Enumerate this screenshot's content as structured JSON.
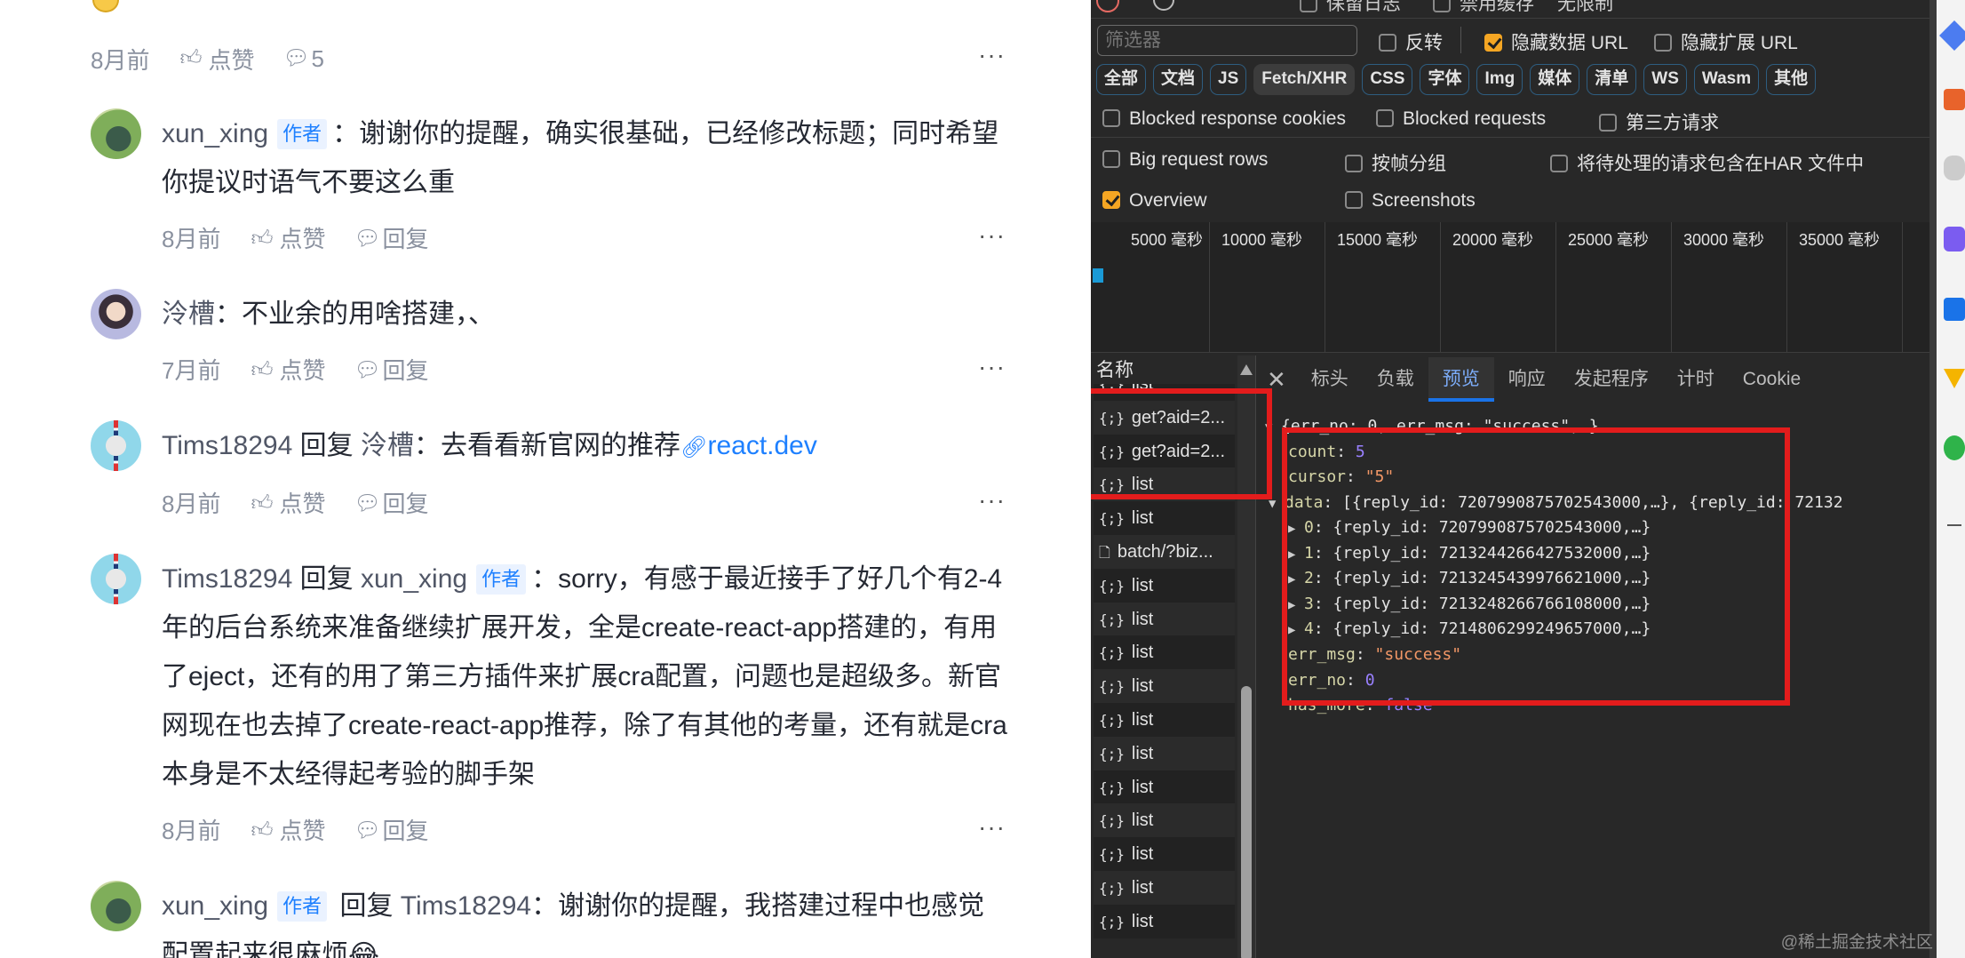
{
  "comments_panel": {
    "top_meta": {
      "time": "8月前",
      "like": "点赞",
      "reply_count": "5",
      "more": "···"
    },
    "author_badge": "作者",
    "reply_word": "回复",
    "comments": [
      {
        "name": "xun_xing",
        "is_author": true,
        "reply_to": null,
        "reply_to_author": false,
        "text": "：谢谢你的提醒，确实很基础，已经修改标题；同时希望你提议时语气不要这么重",
        "link": null,
        "time": "8月前",
        "like": "点赞",
        "reply": "回复",
        "avatar": "green"
      },
      {
        "name": "泠槽",
        "is_author": false,
        "reply_to": null,
        "reply_to_author": false,
        "text": "：不业余的用啥搭建，、",
        "link": null,
        "time": "7月前",
        "like": "点赞",
        "reply": "回复",
        "avatar": "girl"
      },
      {
        "name": "Tims18294",
        "is_author": false,
        "reply_to": "泠槽",
        "reply_to_author": false,
        "text": "：去看看新官网的推荐",
        "link": "react.dev",
        "time": "8月前",
        "like": "点赞",
        "reply": "回复",
        "avatar": "watch"
      },
      {
        "name": "Tims18294",
        "is_author": false,
        "reply_to": "xun_xing",
        "reply_to_author": true,
        "text": "：sorry，有感于最近接手了好几个有2-4年的后台系统来准备继续扩展开发，全是create-react-app搭建的，有用了eject，还有的用了第三方插件来扩展cra配置，问题也是超级多。新官网现在也去掉了create-react-app推荐，除了有其他的考量，还有就是cra本身是不太经得起考验的脚手架",
        "link": null,
        "time": "8月前",
        "like": "点赞",
        "reply": "回复",
        "avatar": "watch"
      },
      {
        "name": "xun_xing",
        "is_author": true,
        "reply_to": "Tims18294",
        "reply_to_author": false,
        "text": "：谢谢你的提醒，我搭建过程中也感觉配置起来很麻烦😂",
        "link": null,
        "time": null,
        "like": null,
        "reply": null,
        "avatar": "green"
      }
    ]
  },
  "devtools": {
    "toolbar": {
      "preserve_log": "保留日志",
      "disable_cache": "禁用缓存",
      "throttle": "无限制"
    },
    "filter": {
      "placeholder": "筛选器",
      "invert": "反转",
      "hide_data_url": "隐藏数据 URL",
      "hide_ext_url": "隐藏扩展 URL",
      "hide_data_url_checked": true
    },
    "types": [
      {
        "label": "全部",
        "active": false
      },
      {
        "label": "文档",
        "active": false
      },
      {
        "label": "JS",
        "active": false
      },
      {
        "label": "Fetch/XHR",
        "active": true
      },
      {
        "label": "CSS",
        "active": false
      },
      {
        "label": "字体",
        "active": false
      },
      {
        "label": "Img",
        "active": false
      },
      {
        "label": "媒体",
        "active": false
      },
      {
        "label": "清单",
        "active": false
      },
      {
        "label": "WS",
        "active": false
      },
      {
        "label": "Wasm",
        "active": false
      },
      {
        "label": "其他",
        "active": false
      }
    ],
    "options": {
      "blocked_cookies": "Blocked response cookies",
      "blocked_requests": "Blocked requests",
      "third_party": "第三方请求",
      "big_rows": "Big request rows",
      "group_by_frame": "按帧分组",
      "har_pending": "将待处理的请求包含在HAR 文件中",
      "overview": "Overview",
      "overview_checked": true,
      "screenshots": "Screenshots"
    },
    "timeline_ticks": [
      "5000 毫秒",
      "10000 毫秒",
      "15000 毫秒",
      "20000 毫秒",
      "25000 毫秒",
      "30000 毫秒",
      "35000 毫秒"
    ],
    "name_header": "名称",
    "requests": [
      {
        "name": "list",
        "icon": "{;}"
      },
      {
        "name": "get?aid=2...",
        "icon": "{;}"
      },
      {
        "name": "get?aid=2...",
        "icon": "{;}"
      },
      {
        "name": "list",
        "icon": "{;}"
      },
      {
        "name": "list",
        "icon": "{;}"
      },
      {
        "name": "batch/?biz...",
        "icon": "doc"
      },
      {
        "name": "list",
        "icon": "{;}"
      },
      {
        "name": "list",
        "icon": "{;}"
      },
      {
        "name": "list",
        "icon": "{;}"
      },
      {
        "name": "list",
        "icon": "{;}"
      },
      {
        "name": "list",
        "icon": "{;}"
      },
      {
        "name": "list",
        "icon": "{;}"
      },
      {
        "name": "list",
        "icon": "{;}"
      },
      {
        "name": "list",
        "icon": "{;}"
      },
      {
        "name": "list",
        "icon": "{;}"
      },
      {
        "name": "list",
        "icon": "{;}"
      },
      {
        "name": "list",
        "icon": "{;}"
      }
    ],
    "detail_tabs": [
      {
        "label": "标头",
        "active": false
      },
      {
        "label": "负载",
        "active": false
      },
      {
        "label": "预览",
        "active": true
      },
      {
        "label": "响应",
        "active": false
      },
      {
        "label": "发起程序",
        "active": false
      },
      {
        "label": "计时",
        "active": false
      },
      {
        "label": "Cookie",
        "active": false
      }
    ],
    "preview": {
      "summary": "{err_no: 0, err_msg: \"success\",…}",
      "count_key": "count",
      "count": "5",
      "cursor_key": "cursor",
      "cursor": "\"5\"",
      "data_key": "data",
      "data_summary": "[{reply_id: 7207990875702543000,…}, {reply_id: 72132",
      "items": [
        {
          "index": "0",
          "value": "{reply_id: 7207990875702543000,…}"
        },
        {
          "index": "1",
          "value": "{reply_id: 7213244266427532000,…}"
        },
        {
          "index": "2",
          "value": "{reply_id: 7213245439976621000,…}"
        },
        {
          "index": "3",
          "value": "{reply_id: 7213248266766108000,…}"
        },
        {
          "index": "4",
          "value": "{reply_id: 7214806299249657000,…}"
        }
      ],
      "err_msg_key": "err_msg",
      "err_msg": "\"success\"",
      "err_no_key": "err_no",
      "err_no": "0",
      "has_more_key": "has_more",
      "has_more": "false"
    },
    "watermark": "@稀土掘金技术社区",
    "highlight_color": "#e31c1c"
  }
}
